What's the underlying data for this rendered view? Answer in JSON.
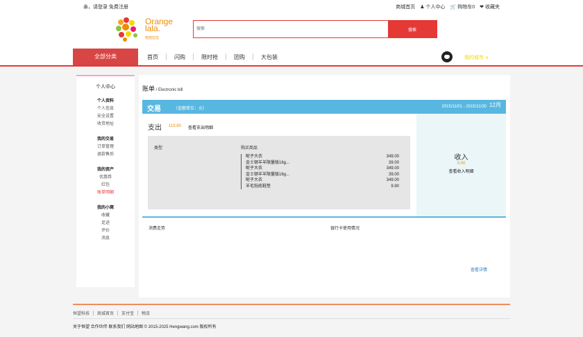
{
  "topbar": {
    "greeting": "亲，请登录 免费注册",
    "links": [
      {
        "icon": "",
        "label": "商城首页"
      },
      {
        "icon": "person-icon",
        "label": "个人中心"
      },
      {
        "icon": "cart-icon",
        "label": "购物车0"
      },
      {
        "icon": "heart-icon",
        "label": "收藏夹"
      }
    ]
  },
  "header": {
    "logo_text_1": "Orange",
    "logo_text_2": "lala.",
    "logo_sub": "桔桔拉拉",
    "search_placeholder": "搜索",
    "search_button": "搜索"
  },
  "nav": {
    "all_categories": "全部分类",
    "items": [
      "首页",
      "闪购",
      "限时抢",
      "团购",
      "大包装"
    ],
    "my_city": "我的城市 ∨"
  },
  "sidebar": {
    "title": "个人中心",
    "groups": [
      {
        "heading": "个人资料",
        "items": [
          "个人信息",
          "安全设置",
          "收货地址"
        ]
      },
      {
        "heading": "我的交易",
        "items": [
          "订单管理",
          "退款售后"
        ]
      },
      {
        "heading": "我的资产",
        "items": [
          "优惠券",
          "红包",
          "账单明细"
        ]
      },
      {
        "heading": "我的小窝",
        "items": [
          "收藏",
          "足迹",
          "评价",
          "消息"
        ]
      }
    ],
    "active_item": "账单明细"
  },
  "main": {
    "breadcrumb_title": "账单",
    "breadcrumb_sub": " / Electronic bill",
    "trade_title": "交易",
    "trade_unit": "（金额单位：元）",
    "date_range": "2015/11/01 - 2015/11/30",
    "month": "12月",
    "spend_label": "支出",
    "spend_amount": "119.80",
    "spend_detail": "查看支出明细",
    "col_type": "类型",
    "col_goods": "购买商品",
    "goods": [
      {
        "name": "呢子大衣",
        "price": "349.00"
      },
      {
        "name": "金士顿羊羊限量版16g...",
        "price": "39.00"
      },
      {
        "name": "呢子大衣",
        "price": "349.00"
      },
      {
        "name": "金士顿羊羊限量版16g...",
        "price": "39.00"
      },
      {
        "name": "呢子大衣",
        "price": "349.00"
      },
      {
        "name": "羊毛毡底鞋垫",
        "price": "9.90"
      }
    ],
    "income_label": "收入",
    "income_amount": "0.00",
    "income_detail": "查看收入明细",
    "trend_label": "消费走势",
    "bank_label": "银行卡使用情况",
    "more_link": "查看详情"
  },
  "footer": {
    "links": [
      "恒望科技",
      "商城首页",
      "支付宝",
      "物流"
    ],
    "copyright": "关于恒望 合作伙伴 联系我们 网站地图 © 2015-2025 Hengwang.com 版权所有"
  },
  "colors": {
    "brand_red": "#e53935",
    "accent_blue": "#58b7e0",
    "accent_orange": "#f08c00"
  }
}
